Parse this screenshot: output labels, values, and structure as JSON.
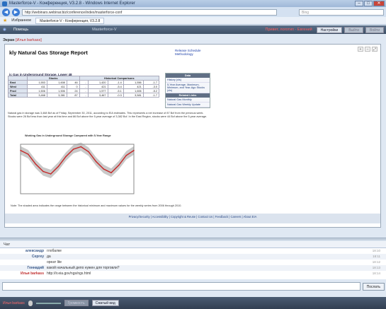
{
  "browser": {
    "title": "Masterforce-V - Конференция, V3.2.8 - Windows Internet Explorer",
    "url": "http://webinars.webinar.biz/conference/index/masterforce-conf",
    "search_placeholder": "Bing",
    "favorites_label": "Избранное",
    "tab_label": "Masterforce-V - Конференция, V3.2.8"
  },
  "app": {
    "help": "Помощь",
    "brand": "Masterforce-V",
    "user": "Привет, логотип - Евгений",
    "settings": "Настройки",
    "exit": "Выйти",
    "enter": "Войти"
  },
  "screen": {
    "label": "Экран",
    "presenter": "[Илья barkass]"
  },
  "doc": {
    "title": "kly Natural Gas Storage Report",
    "links": [
      "Release Schedule",
      "Methodology"
    ],
    "section": "ic Gas in Underground Storage, Lower 48",
    "rows": [
      [
        "East",
        "1,553",
        "1,608",
        "46",
        "-",
        "1,420",
        "-1.4",
        "1,556",
        "-1.7"
      ],
      [
        "West",
        "411",
        "411",
        "0",
        "-",
        "421",
        "-5.4",
        "421",
        "-3.0"
      ],
      [
        "Prod",
        "1,506",
        "1,506",
        "24",
        "-",
        "1,577",
        "-5.1",
        "1,606",
        "-5.2"
      ],
      [
        "Total",
        "3,468",
        "3,381",
        "87",
        "-",
        "3,467",
        "-0.3",
        "3,581",
        "-1.7"
      ]
    ],
    "side_head": "Data",
    "side_items": [
      "History (xls)",
      "5-Year Average, Maximum, Minimum, and Year-Ago Stocks (xls)"
    ],
    "side_head2": "Related Links",
    "side_items2": [
      "Natural Gas Monthly",
      "Natural Gas Weekly Update"
    ],
    "para": "Natural gas in storage was 3,468 Bcf as of Friday, September 30, 2011, according to EIA estimates. This represents a net increase of 87 Bcf from the previous week. Stocks were 26 Bcf less than last year at this time and 86 Bcf above the 5-year average of 3,382 Bcf. In the East Region, stocks were 44 Bcf above the 5-year average.",
    "chart_title": "Working Gas in Underground Storage Compared with 5-Year Range",
    "notes": "Note: The shaded area indicates the range between the historical minimum and maximum values for the weekly series from 2006 through 2010.",
    "footer": "Privacy/Security | Accessibility | Copyright & Reuse | Contact Us | Feedback | Careers | About EIA"
  },
  "chart_data": {
    "type": "line",
    "series": [
      {
        "values": [
          3.5,
          3.2,
          2.4,
          1.8,
          1.6,
          2.2,
          3.0,
          3.6,
          3.8,
          3.4,
          2.6,
          2.0,
          1.7,
          2.3,
          3.1,
          3.5
        ]
      }
    ],
    "ylim": [
      0,
      4
    ]
  },
  "chat": {
    "title": "Чат",
    "messages": [
      {
        "name": "александр",
        "text": "глобалке",
        "time": "18:10"
      },
      {
        "name": "Сергеу",
        "text": "да",
        "time": "18:11"
      },
      {
        "name": "",
        "text": "ореат lite",
        "time": "18:12"
      },
      {
        "name": "Геннадий",
        "text": "какой начальный депо нужен для торговли?",
        "time": "18:13"
      },
      {
        "name": "Илья barkass",
        "text": "http://ir.eia.gov/ngs/ngs.html",
        "time": "18:14"
      }
    ],
    "send": "Послать"
  },
  "status": {
    "name": "Илья barkass",
    "mic": "Громкость",
    "share": "Сжатый вид"
  }
}
